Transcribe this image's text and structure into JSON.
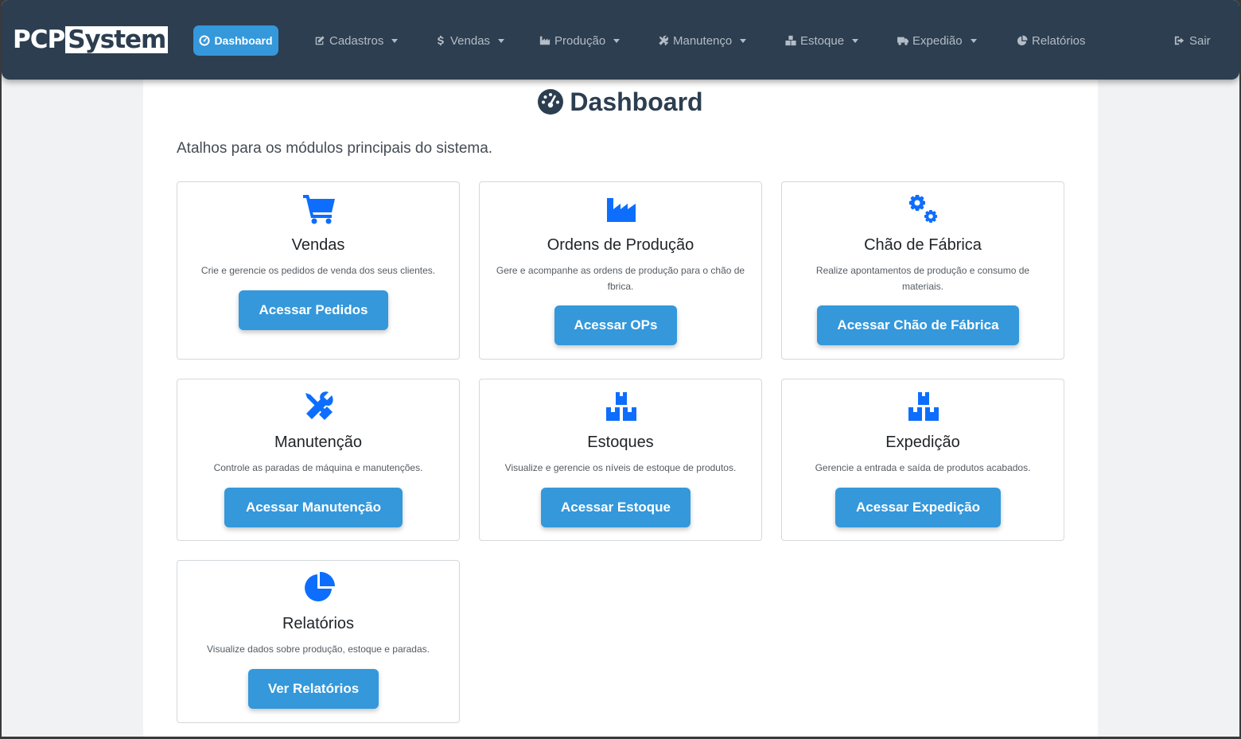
{
  "navbar": {
    "brand_part1": "PCP",
    "brand_part2": "System",
    "items": [
      {
        "label": "Dashboard",
        "icon": "gauge-icon",
        "active": true
      },
      {
        "label": "Cadastros",
        "icon": "edit-icon",
        "dropdown": true
      },
      {
        "label": "Vendas",
        "icon": "dollar-icon",
        "dropdown": true
      },
      {
        "label": "Produção",
        "icon": "industry-icon",
        "dropdown": true
      },
      {
        "label": "Manutenço",
        "icon": "tools-icon",
        "dropdown": true
      },
      {
        "label": "Estoque",
        "icon": "boxes-icon",
        "dropdown": true
      },
      {
        "label": "Expedião",
        "icon": "truck-icon",
        "dropdown": true
      },
      {
        "label": "Relatórios",
        "icon": "chart-pie-icon",
        "dropdown": false
      }
    ],
    "logout_label": "Sair"
  },
  "page": {
    "title": "Dashboard",
    "subtitle": "Atalhos para os módulos principais do sistema."
  },
  "cards": [
    {
      "title": "Vendas",
      "description": "Crie e gerencie os pedidos de venda dos seus clientes.",
      "button": "Acessar Pedidos",
      "icon": "shopping-cart-icon"
    },
    {
      "title": "Ordens de Produção",
      "description": "Gere e acompanhe as ordens de produção para o chão de fbrica.",
      "button": "Acessar OPs",
      "icon": "industry-icon"
    },
    {
      "title": "Chão de Fábrica",
      "description": "Realize apontamentos de produção e consumo de materiais.",
      "button": "Acessar Chão de Fábrica",
      "icon": "cogs-icon"
    },
    {
      "title": "Manutenção",
      "description": "Controle as paradas de máquina e manutenções.",
      "button": "Acessar Manutenção",
      "icon": "tools-icon"
    },
    {
      "title": "Estoques",
      "description": "Visualize e gerencie os níveis de estoque de produtos.",
      "button": "Acessar Estoque",
      "icon": "boxes-icon"
    },
    {
      "title": "Expedição",
      "description": "Gerencie a entrada e saída de produtos acabados.",
      "button": "Acessar Expedição",
      "icon": "boxes-icon"
    },
    {
      "title": "Relatórios",
      "description": "Visualize dados sobre produção, estoque e paradas.",
      "button": "Ver Relatórios",
      "icon": "chart-pie-icon"
    }
  ],
  "colors": {
    "navbar_bg": "#2c3e50",
    "accent": "#3498db",
    "icon_blue": "#0d6efd",
    "nav_text": "#b4bcc6"
  }
}
